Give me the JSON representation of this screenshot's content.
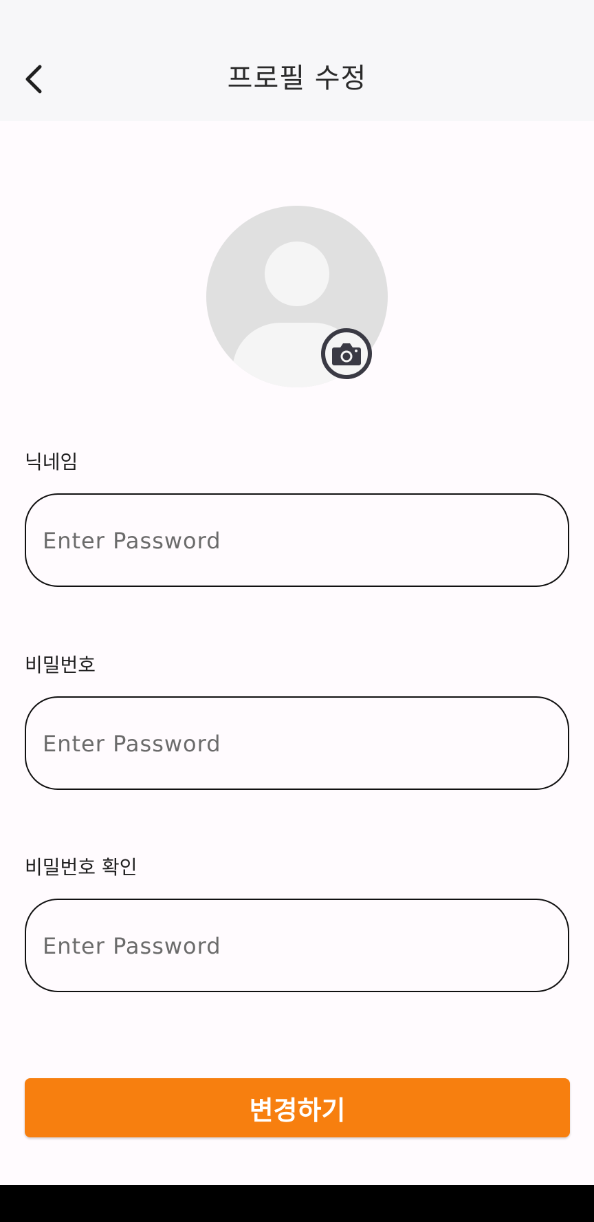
{
  "header": {
    "title": "프로필 수정",
    "back_icon": "chevron-left-icon"
  },
  "profile": {
    "avatar_icon": "default-avatar-icon",
    "camera_icon": "camera-icon"
  },
  "form": {
    "nickname": {
      "label": "닉네임",
      "placeholder": "Enter Password",
      "value": ""
    },
    "password": {
      "label": "비밀번호",
      "placeholder": "Enter Password",
      "value": ""
    },
    "password_confirm": {
      "label": "비밀번호 확인",
      "placeholder": "Enter Password",
      "value": ""
    }
  },
  "submit": {
    "label": "변경하기"
  },
  "colors": {
    "accent": "#f77f0f",
    "header_bg": "#f7f7f9",
    "page_bg": "#fffbfe",
    "avatar_bg": "#e0e0e0"
  }
}
